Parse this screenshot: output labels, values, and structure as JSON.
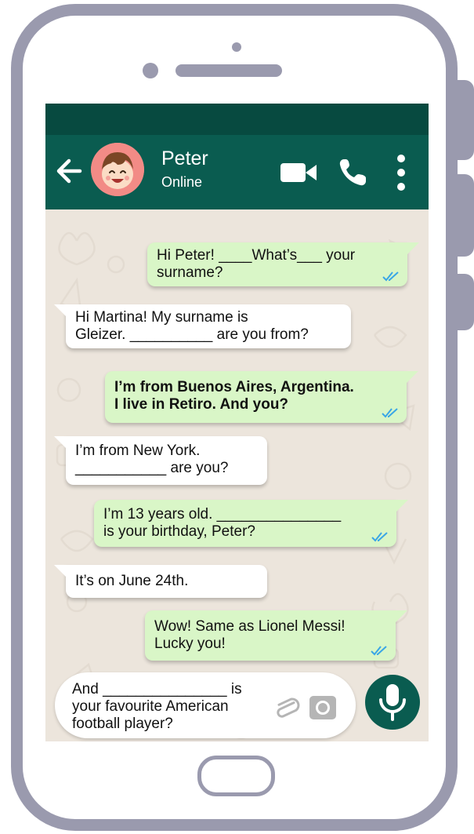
{
  "contact": {
    "name": "Peter",
    "status": "Online"
  },
  "messages": [
    {
      "dir": "out",
      "text": "Hi Peter! ____What’s___ your\nsurname?"
    },
    {
      "dir": "in",
      "text": "Hi Martina! My surname is\nGleizer. __________ are you from?"
    },
    {
      "dir": "out",
      "text": "I’m from Buenos Aires, Argentina.\nI live in Retiro. And you?"
    },
    {
      "dir": "in",
      "text": "I’m from New York.\n___________ are you?"
    },
    {
      "dir": "out",
      "text": "I’m 13 years old. _______________\nis your birthday, Peter?"
    },
    {
      "dir": "in",
      "text": "It’s on June 24th."
    },
    {
      "dir": "out",
      "text": "Wow! Same as Lionel Messi!\nLucky you!"
    }
  ],
  "compose": {
    "text": "And _______________ is\nyour favourite American\nfootball player?"
  },
  "icons": {
    "back": "arrow-left-icon",
    "video": "video-camera-icon",
    "call": "phone-icon",
    "menu": "more-vertical-icon",
    "read": "double-check-icon",
    "attach": "paperclip-icon",
    "camera": "camera-icon",
    "mic": "microphone-icon"
  },
  "colors": {
    "header": "#0a5c50",
    "status_strip": "#074a40",
    "outgoing": "#d9f6c7",
    "incoming": "#ffffff",
    "read_ticks": "#3aa6e6",
    "frame": "#9a9aae"
  }
}
